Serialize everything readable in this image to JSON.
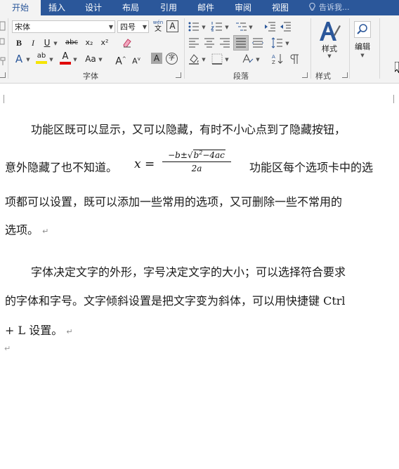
{
  "tabs": [
    {
      "label": "开始",
      "active": true
    },
    {
      "label": "插入",
      "active": false
    },
    {
      "label": "设计",
      "active": false
    },
    {
      "label": "布局",
      "active": false
    },
    {
      "label": "引用",
      "active": false
    },
    {
      "label": "邮件",
      "active": false
    },
    {
      "label": "审阅",
      "active": false
    },
    {
      "label": "视图",
      "active": false
    }
  ],
  "tell_me": "告诉我...",
  "font_group": {
    "font_name": "宋体",
    "font_size": "四号",
    "label": "字体",
    "bold": "B",
    "italic": "I",
    "underline": "U",
    "strikethrough": "abc",
    "subscript": "x₂",
    "superscript": "x²",
    "pinyin_top": "wén",
    "pinyin_bottom": "文",
    "border_char": "A",
    "font_color": "A",
    "highlight": "ab",
    "change_case": "Aa",
    "grow_font": "A",
    "shrink_font": "A",
    "char_shading": "A",
    "enclose": "字",
    "text_effects": "A",
    "highlight_color": "#f5e400",
    "font_color_bar": "#e00000"
  },
  "paragraph_group": {
    "label": "段落"
  },
  "styles_group": {
    "label": "样式",
    "button_label": "样式"
  },
  "editing_group": {
    "button_label": "编辑"
  },
  "accent_color": "#2b579a",
  "document": {
    "p1": {
      "line1": "功能区既可以显示，又可以隐藏，有时不小心点到了隐藏按钮，",
      "line2_before": "意外隐藏了也不知道。",
      "line2_after": "功能区每个选项卡中的选",
      "line3": "项都可以设置，既可以添加一些常用的选项，又可删除一些不常用的",
      "line4": "选项。"
    },
    "formula": {
      "lhs": "x =",
      "numerator_prefix": "−b±",
      "radicand_b": "b",
      "radicand_exp": "2",
      "radicand_rest": "−4ac",
      "denominator": "2a"
    },
    "p2": {
      "line1": "字体决定文字的外形，字号决定文字的大小；可以选择符合要求",
      "line2": "的字体和字号。文字倾斜设置是把文字变为斜体，可以用快捷键 Ctrl",
      "line3": "+ L 设置。"
    },
    "paragraph_mark": "↵"
  }
}
